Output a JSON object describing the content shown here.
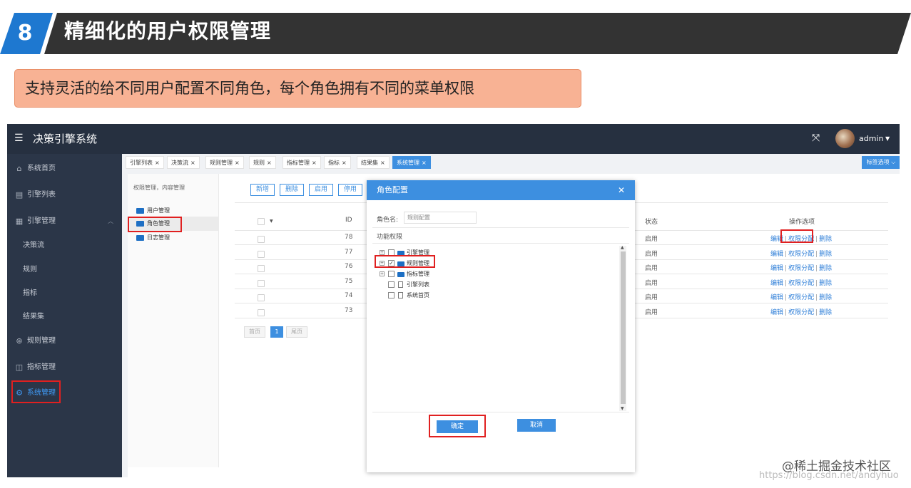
{
  "slide": {
    "number": "8",
    "title": "精细化的用户权限管理",
    "subtitle": "支持灵活的给不同用户配置不同角色，每个角色拥有不同的菜单权限",
    "colors": {
      "accent_blue": "#1e78d0",
      "header_dark": "#333333",
      "subtitle_bg": "#f8b294",
      "highlight_red": "#e02020"
    }
  },
  "app": {
    "title": "决策引擎系统",
    "menu_icon": "hamburger-icon",
    "fullscreen_icon": "fullscreen-icon",
    "user": "admin",
    "sidebar": [
      {
        "icon": "home-icon",
        "glyph": "⌂",
        "label": "系统首页",
        "top": 0
      },
      {
        "icon": "list-icon",
        "glyph": "▤",
        "label": "引擎列表"
      },
      {
        "icon": "grid-icon",
        "glyph": "▦",
        "label": "引擎管理"
      },
      {
        "label": "决策流"
      },
      {
        "label": "规则"
      },
      {
        "label": "指标"
      },
      {
        "label": "结果集"
      },
      {
        "icon": "rule-icon",
        "glyph": "⊛",
        "label": "规则管理"
      },
      {
        "icon": "book-icon",
        "glyph": "◫",
        "label": "指标管理"
      },
      {
        "icon": "gear-icon",
        "glyph": "⚙",
        "label": "系统管理"
      }
    ],
    "tabs": [
      "引擎列表",
      "决策流",
      "规则管理",
      "规则",
      "指标管理",
      "指标",
      "结果集",
      "系统管理"
    ],
    "tab_options": "标签选项",
    "left_panel": {
      "heading": "权限管理，内容管理",
      "items": [
        "用户管理",
        "角色管理",
        "日志管理"
      ]
    },
    "buttons": [
      "新增",
      "删除",
      "启用",
      "停用"
    ],
    "table": {
      "headers": {
        "id": "ID",
        "status": "状态",
        "ops": "操作选项"
      },
      "rows": [
        {
          "id": "78",
          "status": "启用"
        },
        {
          "id": "77",
          "status": "启用"
        },
        {
          "id": "76",
          "status": "启用"
        },
        {
          "id": "75",
          "status": "启用"
        },
        {
          "id": "74",
          "status": "启用"
        },
        {
          "id": "73",
          "status": "启用"
        }
      ],
      "ops": {
        "edit": "编辑",
        "assign": "权限分配",
        "delete": "删除"
      }
    },
    "pager": {
      "first": "首页",
      "current": "1",
      "last": "尾页"
    }
  },
  "dialog": {
    "title": "角色配置",
    "role_name_label": "角色名:",
    "role_name_value": "规则配置",
    "perm_label": "功能权限",
    "tree": [
      {
        "label": "引擎管理",
        "expandable": true,
        "checked": false,
        "type": "folder"
      },
      {
        "label": "规则管理",
        "expandable": true,
        "checked": true,
        "type": "folder"
      },
      {
        "label": "指标管理",
        "expandable": true,
        "checked": false,
        "type": "folder"
      },
      {
        "label": "引擎列表",
        "expandable": false,
        "checked": false,
        "type": "file"
      },
      {
        "label": "系统首页",
        "expandable": false,
        "checked": false,
        "type": "file"
      }
    ],
    "confirm": "确定",
    "cancel": "取消"
  },
  "watermark": {
    "main": "@稀土掘金技术社区",
    "faded": "https://blog.csdn.net/andyhuo"
  }
}
